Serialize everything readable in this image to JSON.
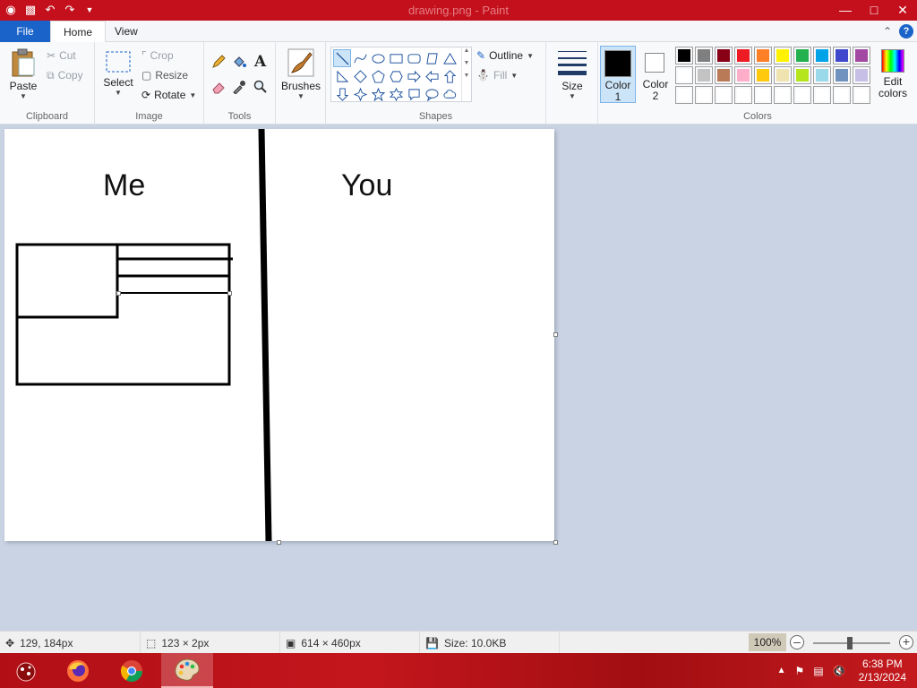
{
  "window": {
    "title": "drawing.png - Paint"
  },
  "tabs": {
    "file": "File",
    "home": "Home",
    "view": "View"
  },
  "clipboard": {
    "paste": "Paste",
    "cut": "Cut",
    "copy": "Copy",
    "label": "Clipboard"
  },
  "image": {
    "select": "Select",
    "crop": "Crop",
    "resize": "Resize",
    "rotate": "Rotate",
    "label": "Image"
  },
  "tools": {
    "label": "Tools"
  },
  "brushes": {
    "label": "Brushes"
  },
  "shapes": {
    "outline": "Outline",
    "fill": "Fill",
    "label": "Shapes"
  },
  "size": {
    "label": "Size"
  },
  "color1": {
    "line1": "Color",
    "line2": "1",
    "value": "#000000"
  },
  "color2": {
    "line1": "Color",
    "line2": "2",
    "value": "#ffffff"
  },
  "colors": {
    "label": "Colors",
    "edit_line1": "Edit",
    "edit_line2": "colors",
    "row1": [
      "#000000",
      "#7f7f7f",
      "#880015",
      "#ed1c24",
      "#ff7f27",
      "#fff200",
      "#22b14c",
      "#00a2e8",
      "#3f48cc",
      "#a349a4"
    ],
    "row2": [
      "#ffffff",
      "#c3c3c3",
      "#b97a57",
      "#ffaec9",
      "#ffc90e",
      "#efe4b0",
      "#b5e61d",
      "#99d9ea",
      "#7092be",
      "#c8bfe7"
    ],
    "row3": [
      "#ffffff",
      "#ffffff",
      "#ffffff",
      "#ffffff",
      "#ffffff",
      "#ffffff",
      "#ffffff",
      "#ffffff",
      "#ffffff",
      "#ffffff"
    ]
  },
  "canvas": {
    "text_me": "Me",
    "text_you": "You"
  },
  "status": {
    "cursor": "129, 184px",
    "selection": "123 × 2px",
    "image_size": "614 × 460px",
    "file_size": "Size: 10.0KB",
    "zoom": "100%"
  },
  "taskbar": {
    "time": "6:38 PM",
    "date": "2/13/2024"
  }
}
